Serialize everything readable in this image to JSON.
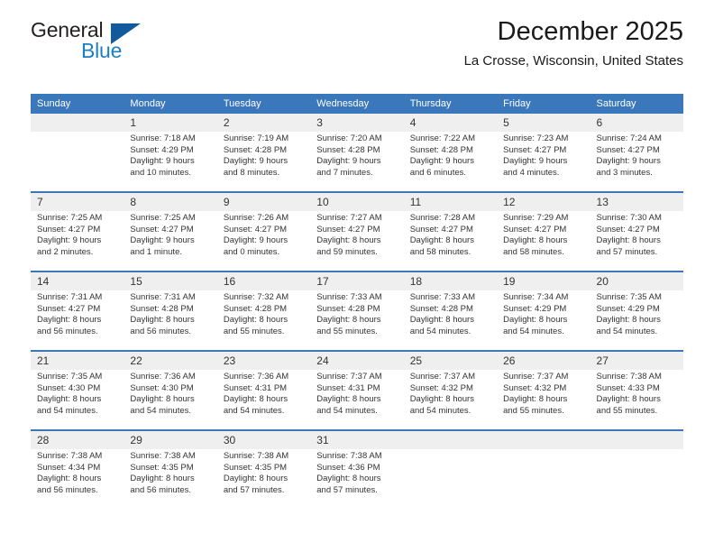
{
  "brand": {
    "name_part1": "General",
    "name_part2": "Blue",
    "triangle_color": "#125a9e",
    "accent_color": "#1c7fc4"
  },
  "header": {
    "title": "December 2025",
    "location": "La Crosse, Wisconsin, United States"
  },
  "theme": {
    "header_bg": "#3a77bb",
    "daynum_bg": "#efefef",
    "text_color": "#333333"
  },
  "weekday_headers": [
    "Sunday",
    "Monday",
    "Tuesday",
    "Wednesday",
    "Thursday",
    "Friday",
    "Saturday"
  ],
  "weeks": [
    {
      "days": [
        {
          "num": "",
          "l1": "",
          "l2": "",
          "l3": "",
          "l4": ""
        },
        {
          "num": "1",
          "l1": "Sunrise: 7:18 AM",
          "l2": "Sunset: 4:29 PM",
          "l3": "Daylight: 9 hours",
          "l4": "and 10 minutes."
        },
        {
          "num": "2",
          "l1": "Sunrise: 7:19 AM",
          "l2": "Sunset: 4:28 PM",
          "l3": "Daylight: 9 hours",
          "l4": "and 8 minutes."
        },
        {
          "num": "3",
          "l1": "Sunrise: 7:20 AM",
          "l2": "Sunset: 4:28 PM",
          "l3": "Daylight: 9 hours",
          "l4": "and 7 minutes."
        },
        {
          "num": "4",
          "l1": "Sunrise: 7:22 AM",
          "l2": "Sunset: 4:28 PM",
          "l3": "Daylight: 9 hours",
          "l4": "and 6 minutes."
        },
        {
          "num": "5",
          "l1": "Sunrise: 7:23 AM",
          "l2": "Sunset: 4:27 PM",
          "l3": "Daylight: 9 hours",
          "l4": "and 4 minutes."
        },
        {
          "num": "6",
          "l1": "Sunrise: 7:24 AM",
          "l2": "Sunset: 4:27 PM",
          "l3": "Daylight: 9 hours",
          "l4": "and 3 minutes."
        }
      ]
    },
    {
      "days": [
        {
          "num": "7",
          "l1": "Sunrise: 7:25 AM",
          "l2": "Sunset: 4:27 PM",
          "l3": "Daylight: 9 hours",
          "l4": "and 2 minutes."
        },
        {
          "num": "8",
          "l1": "Sunrise: 7:25 AM",
          "l2": "Sunset: 4:27 PM",
          "l3": "Daylight: 9 hours",
          "l4": "and 1 minute."
        },
        {
          "num": "9",
          "l1": "Sunrise: 7:26 AM",
          "l2": "Sunset: 4:27 PM",
          "l3": "Daylight: 9 hours",
          "l4": "and 0 minutes."
        },
        {
          "num": "10",
          "l1": "Sunrise: 7:27 AM",
          "l2": "Sunset: 4:27 PM",
          "l3": "Daylight: 8 hours",
          "l4": "and 59 minutes."
        },
        {
          "num": "11",
          "l1": "Sunrise: 7:28 AM",
          "l2": "Sunset: 4:27 PM",
          "l3": "Daylight: 8 hours",
          "l4": "and 58 minutes."
        },
        {
          "num": "12",
          "l1": "Sunrise: 7:29 AM",
          "l2": "Sunset: 4:27 PM",
          "l3": "Daylight: 8 hours",
          "l4": "and 58 minutes."
        },
        {
          "num": "13",
          "l1": "Sunrise: 7:30 AM",
          "l2": "Sunset: 4:27 PM",
          "l3": "Daylight: 8 hours",
          "l4": "and 57 minutes."
        }
      ]
    },
    {
      "days": [
        {
          "num": "14",
          "l1": "Sunrise: 7:31 AM",
          "l2": "Sunset: 4:27 PM",
          "l3": "Daylight: 8 hours",
          "l4": "and 56 minutes."
        },
        {
          "num": "15",
          "l1": "Sunrise: 7:31 AM",
          "l2": "Sunset: 4:28 PM",
          "l3": "Daylight: 8 hours",
          "l4": "and 56 minutes."
        },
        {
          "num": "16",
          "l1": "Sunrise: 7:32 AM",
          "l2": "Sunset: 4:28 PM",
          "l3": "Daylight: 8 hours",
          "l4": "and 55 minutes."
        },
        {
          "num": "17",
          "l1": "Sunrise: 7:33 AM",
          "l2": "Sunset: 4:28 PM",
          "l3": "Daylight: 8 hours",
          "l4": "and 55 minutes."
        },
        {
          "num": "18",
          "l1": "Sunrise: 7:33 AM",
          "l2": "Sunset: 4:28 PM",
          "l3": "Daylight: 8 hours",
          "l4": "and 54 minutes."
        },
        {
          "num": "19",
          "l1": "Sunrise: 7:34 AM",
          "l2": "Sunset: 4:29 PM",
          "l3": "Daylight: 8 hours",
          "l4": "and 54 minutes."
        },
        {
          "num": "20",
          "l1": "Sunrise: 7:35 AM",
          "l2": "Sunset: 4:29 PM",
          "l3": "Daylight: 8 hours",
          "l4": "and 54 minutes."
        }
      ]
    },
    {
      "days": [
        {
          "num": "21",
          "l1": "Sunrise: 7:35 AM",
          "l2": "Sunset: 4:30 PM",
          "l3": "Daylight: 8 hours",
          "l4": "and 54 minutes."
        },
        {
          "num": "22",
          "l1": "Sunrise: 7:36 AM",
          "l2": "Sunset: 4:30 PM",
          "l3": "Daylight: 8 hours",
          "l4": "and 54 minutes."
        },
        {
          "num": "23",
          "l1": "Sunrise: 7:36 AM",
          "l2": "Sunset: 4:31 PM",
          "l3": "Daylight: 8 hours",
          "l4": "and 54 minutes."
        },
        {
          "num": "24",
          "l1": "Sunrise: 7:37 AM",
          "l2": "Sunset: 4:31 PM",
          "l3": "Daylight: 8 hours",
          "l4": "and 54 minutes."
        },
        {
          "num": "25",
          "l1": "Sunrise: 7:37 AM",
          "l2": "Sunset: 4:32 PM",
          "l3": "Daylight: 8 hours",
          "l4": "and 54 minutes."
        },
        {
          "num": "26",
          "l1": "Sunrise: 7:37 AM",
          "l2": "Sunset: 4:32 PM",
          "l3": "Daylight: 8 hours",
          "l4": "and 55 minutes."
        },
        {
          "num": "27",
          "l1": "Sunrise: 7:38 AM",
          "l2": "Sunset: 4:33 PM",
          "l3": "Daylight: 8 hours",
          "l4": "and 55 minutes."
        }
      ]
    },
    {
      "days": [
        {
          "num": "28",
          "l1": "Sunrise: 7:38 AM",
          "l2": "Sunset: 4:34 PM",
          "l3": "Daylight: 8 hours",
          "l4": "and 56 minutes."
        },
        {
          "num": "29",
          "l1": "Sunrise: 7:38 AM",
          "l2": "Sunset: 4:35 PM",
          "l3": "Daylight: 8 hours",
          "l4": "and 56 minutes."
        },
        {
          "num": "30",
          "l1": "Sunrise: 7:38 AM",
          "l2": "Sunset: 4:35 PM",
          "l3": "Daylight: 8 hours",
          "l4": "and 57 minutes."
        },
        {
          "num": "31",
          "l1": "Sunrise: 7:38 AM",
          "l2": "Sunset: 4:36 PM",
          "l3": "Daylight: 8 hours",
          "l4": "and 57 minutes."
        },
        {
          "num": "",
          "l1": "",
          "l2": "",
          "l3": "",
          "l4": ""
        },
        {
          "num": "",
          "l1": "",
          "l2": "",
          "l3": "",
          "l4": ""
        },
        {
          "num": "",
          "l1": "",
          "l2": "",
          "l3": "",
          "l4": ""
        }
      ]
    }
  ]
}
